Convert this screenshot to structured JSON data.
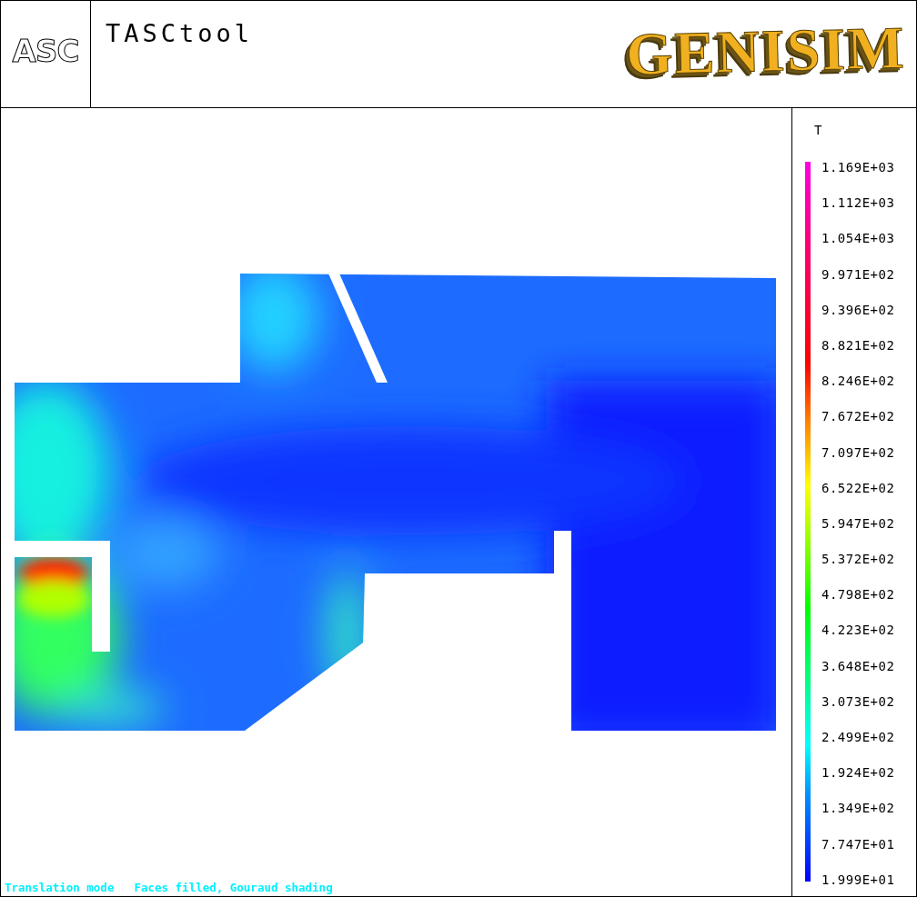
{
  "header": {
    "logo": "ASC",
    "app_title": "TASCtool",
    "brand": "GENISIM"
  },
  "legend": {
    "title": "T",
    "labels": [
      "1.169E+03",
      "1.112E+03",
      "1.054E+03",
      "9.971E+02",
      "9.396E+02",
      "8.821E+02",
      "8.246E+02",
      "7.672E+02",
      "7.097E+02",
      "6.522E+02",
      "5.947E+02",
      "5.372E+02",
      "4.798E+02",
      "4.223E+02",
      "3.648E+02",
      "3.073E+02",
      "2.499E+02",
      "1.924E+02",
      "1.349E+02",
      "7.747E+01",
      "1.999E+01"
    ]
  },
  "status_bar": {
    "mode": "Translation mode",
    "render": "Faces filled, Gouraud shading"
  }
}
